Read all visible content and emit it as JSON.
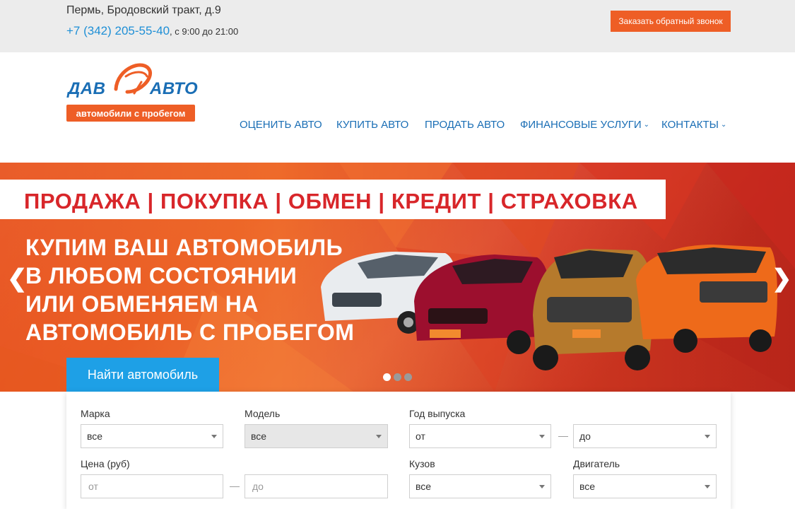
{
  "topbar": {
    "address": "Пермь, Бродовский тракт, д.9",
    "phone": "+7 (342) 205-55-40",
    "hours": ", с 9:00 до 21:00",
    "callback_label": "Заказать обратный звонок"
  },
  "logo": {
    "word_left": "ДАВ",
    "word_right": "АВТО",
    "tagline": "автомобили с пробегом"
  },
  "nav": {
    "items": [
      {
        "label": "ОЦЕНИТЬ АВТО",
        "dropdown": false
      },
      {
        "label": "КУПИТЬ АВТО",
        "dropdown": false
      },
      {
        "label": "ПРОДАТЬ АВТО",
        "dropdown": false
      },
      {
        "label": "ФИНАНСОВЫЕ УСЛУГИ",
        "dropdown": true
      },
      {
        "label": "КОНТАКТЫ",
        "dropdown": true
      }
    ]
  },
  "banner": {
    "services": "ПРОДАЖА | ПОКУПКА | ОБМЕН | КРЕДИТ | СТРАХОВКА",
    "headline": [
      "КУПИМ ВАШ АВТОМОБИЛЬ",
      "В ЛЮБОМ СОСТОЯНИИ",
      "ИЛИ ОБМЕНЯЕМ НА",
      "АВТОМОБИЛЬ С ПРОБЕГОМ"
    ],
    "prev_icon": "chevron-left-icon",
    "next_icon": "chevron-right-icon",
    "slides_count": 3,
    "active_slide": 1,
    "colors": {
      "accent": "#ee5e26",
      "service_text": "#d8262a"
    }
  },
  "search": {
    "tab_label": "Найти автомобиль",
    "brand": {
      "label": "Марка",
      "value": "все"
    },
    "model": {
      "label": "Модель",
      "value": "все"
    },
    "year": {
      "label": "Год выпуска",
      "from": "от",
      "to": "до"
    },
    "price": {
      "label": "Цена (руб)",
      "from_placeholder": "от",
      "to_placeholder": "до"
    },
    "body": {
      "label": "Кузов",
      "value": "все"
    },
    "engine": {
      "label": "Двигатель",
      "value": "все"
    },
    "separator": "—"
  }
}
